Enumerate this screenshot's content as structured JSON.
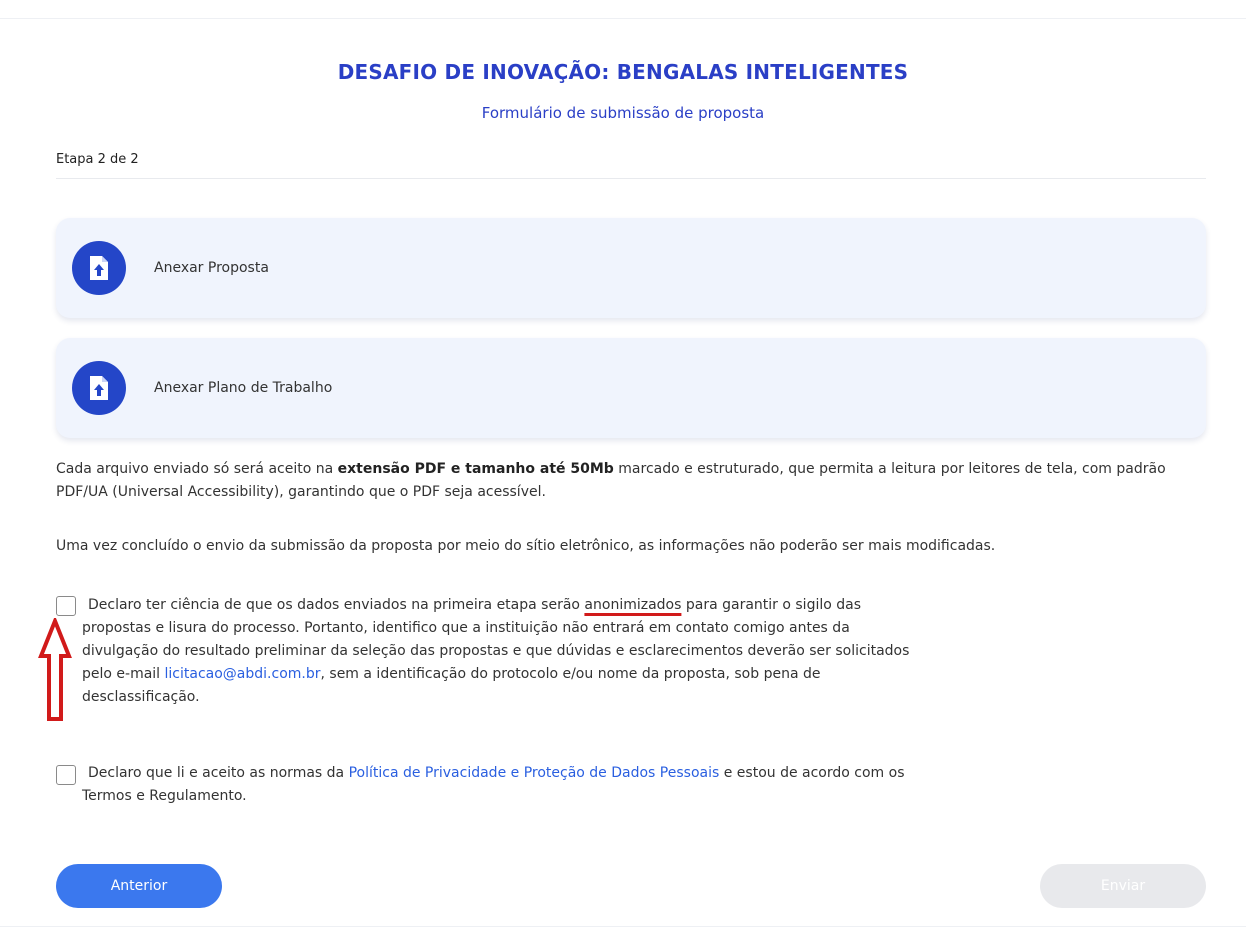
{
  "header": {
    "title": "DESAFIO DE INOVAÇÃO: BENGALAS INTELIGENTES",
    "subtitle": "Formulário de submissão de proposta"
  },
  "progress": {
    "step_text": "Etapa 2 de 2",
    "current_step": 2,
    "total_steps": 2
  },
  "uploads": [
    {
      "label": "Anexar Proposta",
      "icon": "file-upload-icon"
    },
    {
      "label": "Anexar Plano de Trabalho",
      "icon": "file-upload-icon"
    }
  ],
  "info": {
    "p1_before": "Cada arquivo enviado só será aceito na ",
    "p1_bold": "extensão PDF e tamanho até 50Mb",
    "p1_after": " marcado e estruturado, que permita a leitura por leitores de tela, com padrão PDF/UA (Universal Accessibility), garantindo que o PDF seja acessível.",
    "p2": "Uma vez concluído o envio da submissão da proposta por meio do sítio eletrônico, as informações não poderão ser mais modificadas."
  },
  "declarations": {
    "d1": {
      "checked": false,
      "before": "Declaro ter ciência de que os dados enviados na primeira etapa serão ",
      "highlight": "anonimizados",
      "middle": " para garantir o sigilo das propostas e lisura do processo. Portanto, identifico que a instituição não entrará em contato comigo antes da divulgação do resultado preliminar da seleção das propostas e que dúvidas e esclarecimentos deverão ser solicitados pelo e-mail ",
      "email": "licitacao@abdi.com.br",
      "after": ", sem a identificação do protocolo e/ou nome da proposta, sob pena de desclassificação."
    },
    "d2": {
      "checked": false,
      "before": "Declaro que li e aceito as normas da ",
      "link": "Política de Privacidade e Proteção de Dados Pessoais",
      "after": " e estou de acordo com os Termos e Regulamento."
    }
  },
  "buttons": {
    "prev_label": "Anterior",
    "send_label": "Enviar",
    "send_disabled": true
  },
  "colors": {
    "title": "#2a3fc6",
    "primary_button": "#3b78ee",
    "icon_circle": "#2446c8",
    "card_bg": "#f0f4fd",
    "link": "#2a5fe0",
    "annotation_red": "#d11a1a",
    "disabled_button": "#e8e9ec"
  }
}
